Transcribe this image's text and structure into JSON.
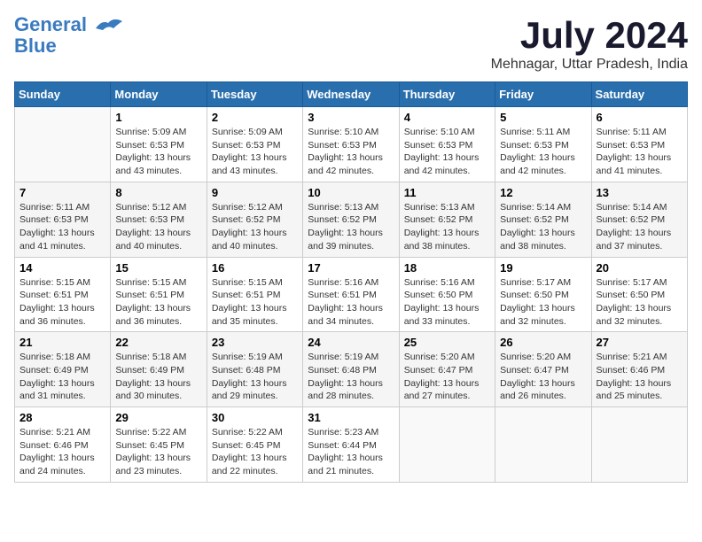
{
  "header": {
    "logo_line1": "General",
    "logo_line2": "Blue",
    "month_year": "July 2024",
    "location": "Mehnagar, Uttar Pradesh, India"
  },
  "columns": [
    "Sunday",
    "Monday",
    "Tuesday",
    "Wednesday",
    "Thursday",
    "Friday",
    "Saturday"
  ],
  "weeks": [
    [
      {
        "day": "",
        "info": ""
      },
      {
        "day": "1",
        "info": "Sunrise: 5:09 AM\nSunset: 6:53 PM\nDaylight: 13 hours\nand 43 minutes."
      },
      {
        "day": "2",
        "info": "Sunrise: 5:09 AM\nSunset: 6:53 PM\nDaylight: 13 hours\nand 43 minutes."
      },
      {
        "day": "3",
        "info": "Sunrise: 5:10 AM\nSunset: 6:53 PM\nDaylight: 13 hours\nand 42 minutes."
      },
      {
        "day": "4",
        "info": "Sunrise: 5:10 AM\nSunset: 6:53 PM\nDaylight: 13 hours\nand 42 minutes."
      },
      {
        "day": "5",
        "info": "Sunrise: 5:11 AM\nSunset: 6:53 PM\nDaylight: 13 hours\nand 42 minutes."
      },
      {
        "day": "6",
        "info": "Sunrise: 5:11 AM\nSunset: 6:53 PM\nDaylight: 13 hours\nand 41 minutes."
      }
    ],
    [
      {
        "day": "7",
        "info": "Sunrise: 5:11 AM\nSunset: 6:53 PM\nDaylight: 13 hours\nand 41 minutes."
      },
      {
        "day": "8",
        "info": "Sunrise: 5:12 AM\nSunset: 6:53 PM\nDaylight: 13 hours\nand 40 minutes."
      },
      {
        "day": "9",
        "info": "Sunrise: 5:12 AM\nSunset: 6:52 PM\nDaylight: 13 hours\nand 40 minutes."
      },
      {
        "day": "10",
        "info": "Sunrise: 5:13 AM\nSunset: 6:52 PM\nDaylight: 13 hours\nand 39 minutes."
      },
      {
        "day": "11",
        "info": "Sunrise: 5:13 AM\nSunset: 6:52 PM\nDaylight: 13 hours\nand 38 minutes."
      },
      {
        "day": "12",
        "info": "Sunrise: 5:14 AM\nSunset: 6:52 PM\nDaylight: 13 hours\nand 38 minutes."
      },
      {
        "day": "13",
        "info": "Sunrise: 5:14 AM\nSunset: 6:52 PM\nDaylight: 13 hours\nand 37 minutes."
      }
    ],
    [
      {
        "day": "14",
        "info": "Sunrise: 5:15 AM\nSunset: 6:51 PM\nDaylight: 13 hours\nand 36 minutes."
      },
      {
        "day": "15",
        "info": "Sunrise: 5:15 AM\nSunset: 6:51 PM\nDaylight: 13 hours\nand 36 minutes."
      },
      {
        "day": "16",
        "info": "Sunrise: 5:15 AM\nSunset: 6:51 PM\nDaylight: 13 hours\nand 35 minutes."
      },
      {
        "day": "17",
        "info": "Sunrise: 5:16 AM\nSunset: 6:51 PM\nDaylight: 13 hours\nand 34 minutes."
      },
      {
        "day": "18",
        "info": "Sunrise: 5:16 AM\nSunset: 6:50 PM\nDaylight: 13 hours\nand 33 minutes."
      },
      {
        "day": "19",
        "info": "Sunrise: 5:17 AM\nSunset: 6:50 PM\nDaylight: 13 hours\nand 32 minutes."
      },
      {
        "day": "20",
        "info": "Sunrise: 5:17 AM\nSunset: 6:50 PM\nDaylight: 13 hours\nand 32 minutes."
      }
    ],
    [
      {
        "day": "21",
        "info": "Sunrise: 5:18 AM\nSunset: 6:49 PM\nDaylight: 13 hours\nand 31 minutes."
      },
      {
        "day": "22",
        "info": "Sunrise: 5:18 AM\nSunset: 6:49 PM\nDaylight: 13 hours\nand 30 minutes."
      },
      {
        "day": "23",
        "info": "Sunrise: 5:19 AM\nSunset: 6:48 PM\nDaylight: 13 hours\nand 29 minutes."
      },
      {
        "day": "24",
        "info": "Sunrise: 5:19 AM\nSunset: 6:48 PM\nDaylight: 13 hours\nand 28 minutes."
      },
      {
        "day": "25",
        "info": "Sunrise: 5:20 AM\nSunset: 6:47 PM\nDaylight: 13 hours\nand 27 minutes."
      },
      {
        "day": "26",
        "info": "Sunrise: 5:20 AM\nSunset: 6:47 PM\nDaylight: 13 hours\nand 26 minutes."
      },
      {
        "day": "27",
        "info": "Sunrise: 5:21 AM\nSunset: 6:46 PM\nDaylight: 13 hours\nand 25 minutes."
      }
    ],
    [
      {
        "day": "28",
        "info": "Sunrise: 5:21 AM\nSunset: 6:46 PM\nDaylight: 13 hours\nand 24 minutes."
      },
      {
        "day": "29",
        "info": "Sunrise: 5:22 AM\nSunset: 6:45 PM\nDaylight: 13 hours\nand 23 minutes."
      },
      {
        "day": "30",
        "info": "Sunrise: 5:22 AM\nSunset: 6:45 PM\nDaylight: 13 hours\nand 22 minutes."
      },
      {
        "day": "31",
        "info": "Sunrise: 5:23 AM\nSunset: 6:44 PM\nDaylight: 13 hours\nand 21 minutes."
      },
      {
        "day": "",
        "info": ""
      },
      {
        "day": "",
        "info": ""
      },
      {
        "day": "",
        "info": ""
      }
    ]
  ]
}
